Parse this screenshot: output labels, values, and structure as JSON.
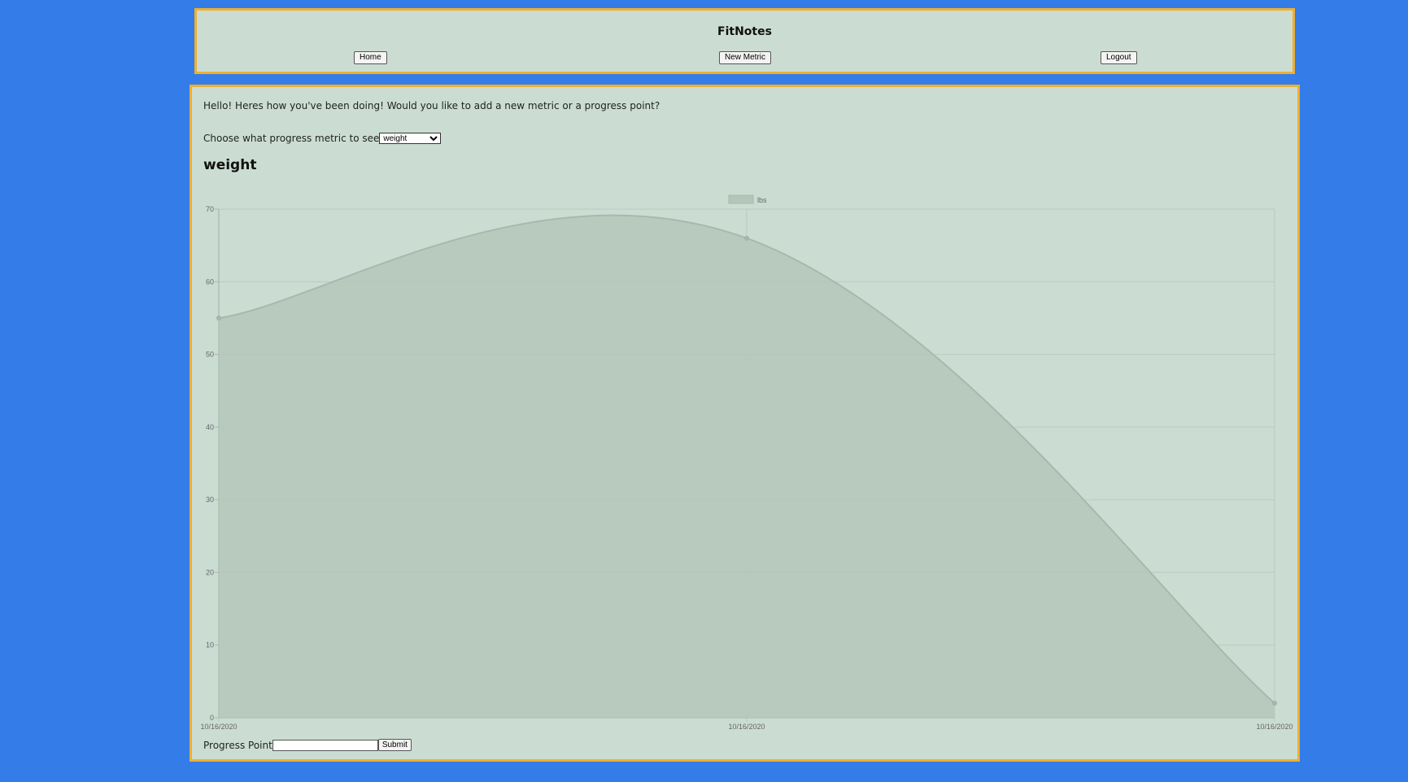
{
  "header": {
    "title": "FitNotes",
    "nav": {
      "home": "Home",
      "new_metric": "New Metric",
      "logout": "Logout"
    }
  },
  "main": {
    "greeting": "Hello! Heres how you've been doing! Would you like to add a new metric or a progress point?",
    "choose_label": "Choose what progress metric to see",
    "selected_metric": "weight",
    "metric_title": "weight",
    "progress_label": "Progress Point",
    "progress_value": "",
    "submit_label": "Submit"
  },
  "colors": {
    "page_background": "#347ce8",
    "panel_background": "#cbddd3",
    "panel_border": "#f0b030",
    "series_fill": "#b5c5ba",
    "series_line": "#a8b8ae"
  },
  "chart_data": {
    "type": "area",
    "x": [
      "10/16/2020",
      "10/16/2020",
      "10/16/2020"
    ],
    "series": [
      {
        "name": "lbs",
        "values": [
          55,
          66,
          2
        ]
      }
    ],
    "ylim": [
      0,
      70
    ],
    "yticks": [
      0,
      10,
      20,
      30,
      40,
      50,
      60,
      70
    ],
    "grid": true,
    "legend": "top-center"
  }
}
